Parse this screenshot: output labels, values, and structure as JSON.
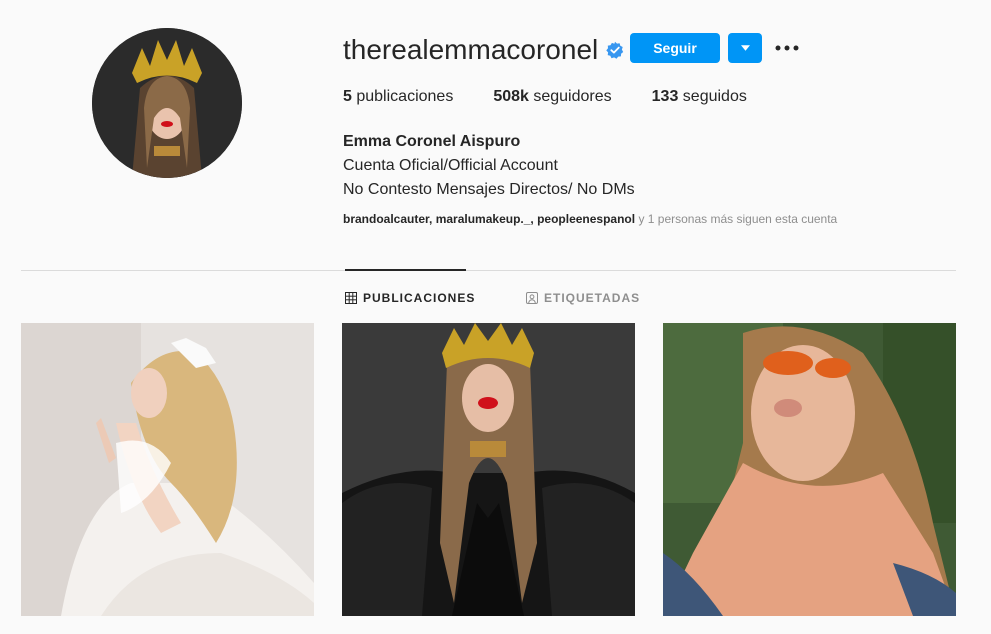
{
  "profile": {
    "username": "therealemmacoronel",
    "verified": true,
    "follow_label": "Seguir",
    "stats": {
      "posts_count": "5",
      "posts_label": "publicaciones",
      "followers_count": "508k",
      "followers_label": "seguidores",
      "following_count": "133",
      "following_label": "seguidos"
    },
    "bio": {
      "name": "Emma Coronel Aispuro",
      "line1": "Cuenta Oficial/Official Account",
      "line2": "No Contesto Mensajes Directos/ No DMs"
    },
    "followed_by": {
      "names": "brandoalcauter, maralumakeup._, peopleenespanol",
      "suffix": " y 1 personas más siguen esta cuenta"
    }
  },
  "tabs": [
    {
      "label": "PUBLICACIONES",
      "icon": "grid-icon",
      "active": true
    },
    {
      "label": "ETIQUETADAS",
      "icon": "tagged-icon",
      "active": false
    }
  ],
  "colors": {
    "accent": "#0095f6",
    "background": "#fafafa",
    "text": "#262626",
    "muted": "#8e8e8e",
    "divider": "#dbdbdb"
  }
}
